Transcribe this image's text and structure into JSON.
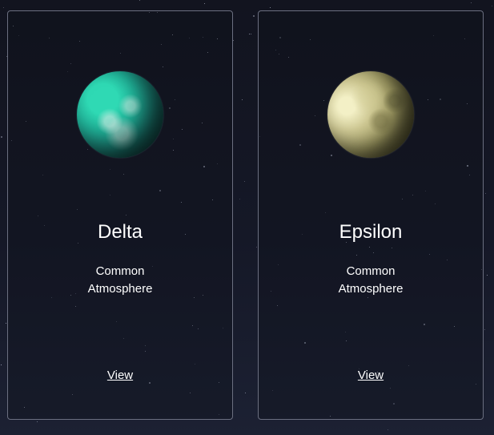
{
  "cards": [
    {
      "name": "Delta",
      "rarity": "Common",
      "type": "Atmosphere",
      "link_label": "View",
      "planet_icon": "teal-cloudy-planet-icon"
    },
    {
      "name": "Epsilon",
      "rarity": "Common",
      "type": "Atmosphere",
      "link_label": "View",
      "planet_icon": "olive-rocky-planet-icon"
    }
  ],
  "colors": {
    "background": "#14172a",
    "card_border": "#6b6f80",
    "text": "#ffffff",
    "delta_planet": "#1fae95",
    "epsilon_planet": "#cdc792"
  }
}
